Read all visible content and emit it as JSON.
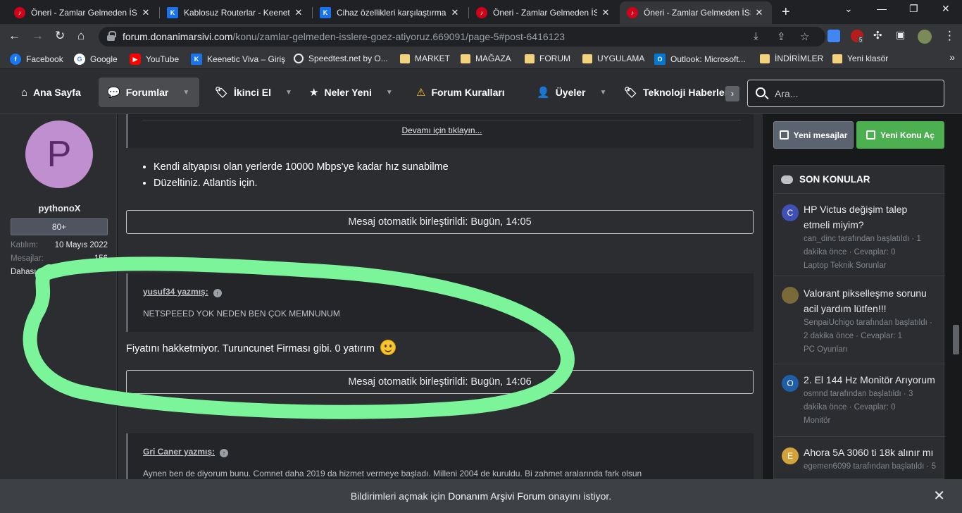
{
  "browser": {
    "tabs": [
      {
        "title": "Öneri - Zamlar Gelmeden İSS",
        "favicon": "red"
      },
      {
        "title": "Kablosuz Routerlar - Keenetic",
        "favicon": "blue"
      },
      {
        "title": "Cihaz özellikleri karşılaştırma",
        "favicon": "blue"
      },
      {
        "title": "Öneri - Zamlar Gelmeden İSS",
        "favicon": "red"
      },
      {
        "title": "Öneri - Zamlar Gelmeden İSS",
        "favicon": "red",
        "active": true
      }
    ],
    "url_domain": "forum.donanimarsivi.com",
    "url_path": "/konu/zamlar-gelmeden-isslere-goez-atiyoruz.669091/page-5#post-6416123",
    "extension_badge": "5",
    "bookmarks": [
      {
        "label": "Facebook",
        "icon": "facebook-icon"
      },
      {
        "label": "Google",
        "icon": "google-icon"
      },
      {
        "label": "YouTube",
        "icon": "youtube-icon"
      },
      {
        "label": "Keenetic Viva – Giriş",
        "icon": "keenetic-icon"
      },
      {
        "label": "Speedtest.net by O...",
        "icon": "speedtest-icon"
      },
      {
        "label": "MARKET",
        "icon": "folder-icon"
      },
      {
        "label": "MAĞAZA",
        "icon": "folder-icon"
      },
      {
        "label": "FORUM",
        "icon": "folder-icon"
      },
      {
        "label": "UYGULAMA",
        "icon": "folder-icon"
      },
      {
        "label": "Outlook: Microsoft...",
        "icon": "outlook-icon"
      },
      {
        "label": "İNDİRİMLER",
        "icon": "folder-icon"
      },
      {
        "label": "Yeni klasör",
        "icon": "folder-icon"
      }
    ]
  },
  "forum_nav": {
    "items": [
      {
        "label": "Ana Sayfa",
        "icon": "home-icon"
      },
      {
        "label": "Forumlar",
        "icon": "comments-icon"
      },
      {
        "label": "İkinci El",
        "icon": "tag-icon"
      },
      {
        "label": "Neler Yeni",
        "icon": "star-icon"
      },
      {
        "label": "Forum Kuralları",
        "icon": "warning-icon"
      },
      {
        "label": "Üyeler",
        "icon": "user-icon"
      },
      {
        "label": "Teknoloji Haberleri",
        "icon": "tag-icon"
      }
    ],
    "search_placeholder": "Ara..."
  },
  "user": {
    "avatar_letter": "P",
    "name": "pythonoX",
    "badge": "80+",
    "joined_label": "Katılım:",
    "joined_value": "10 Mayıs 2022",
    "messages_label": "Mesajlar:",
    "messages_value": "156",
    "more_label": "Dahası"
  },
  "post": {
    "expand_link": "Devamı için tıklayın...",
    "bullets": [
      "Kendi altyapısı olan yerlerde 10000 Mbps'ye kadar hız sunabilme",
      "Düzeltiniz. Atlantis için."
    ],
    "merge_1": "Mesaj otomatik birleştirildi: Bugün, 14:05",
    "quote_1_author": "yusuf34 yazmış:",
    "quote_1_text": "NETSPEEED YOK NEDEN BEN ÇOK MEMNUNUM",
    "reply_text": "Fiyatını hakketmiyor. Turuncunet Firması gibi. 0 yatırım",
    "merge_2": "Mesaj otomatik birleştirildi: Bugün, 14:06",
    "quote_2_author": "Gri Caner yazmış:",
    "quote_2_text": "Aynen ben de diyorum bunu. Comnet daha 2019 da hizmet vermeye başladı. Milleni 2004 de kuruldu. Bi zahmet aralarında fark olsun"
  },
  "sidebar": {
    "new_messages_btn": "Yeni mesajlar",
    "new_topic_btn": "Yeni Konu Aç",
    "block_title": "SON KONULAR",
    "topics": [
      {
        "avatar": "C",
        "color": "#3f51b5",
        "title": "HP Victus değişim talep etmeli miyim?",
        "meta": "can_dinc tarafından başlatıldı · 1 dakika önce · Cevaplar: 0",
        "forum": "Laptop Teknik Sorunlar"
      },
      {
        "avatar": "",
        "color": "#7a6a3a",
        "title": "Valorant pikselleşme sorunu acil yardım lütfen!!!",
        "meta": "SenpaiUchigo tarafından başlatıldı · 2 dakika önce · Cevaplar: 1",
        "forum": "PC Oyunları"
      },
      {
        "avatar": "O",
        "color": "#1e5fa8",
        "title": "2. El 144 Hz Monitör Arıyorum",
        "meta": "osmnd tarafından başlatıldı · 3 dakika önce · Cevaplar: 0",
        "forum": "Monitör"
      },
      {
        "avatar": "E",
        "color": "#d4a23a",
        "title": "Ahora 5A 3060 ti 18k alınır mı",
        "meta": "egemen6099 tarafından başlatıldı · 5",
        "forum": ""
      }
    ]
  },
  "notification": {
    "prefix": "Bildirimleri açmak için ",
    "site": "Donanım Arşivi Forum",
    "suffix": " onayını istiyor."
  },
  "colors": {
    "highlight": "#7cf59a",
    "accent_green": "#4caf50",
    "page_bg": "#18191b",
    "panel_bg": "#2b2d31"
  }
}
